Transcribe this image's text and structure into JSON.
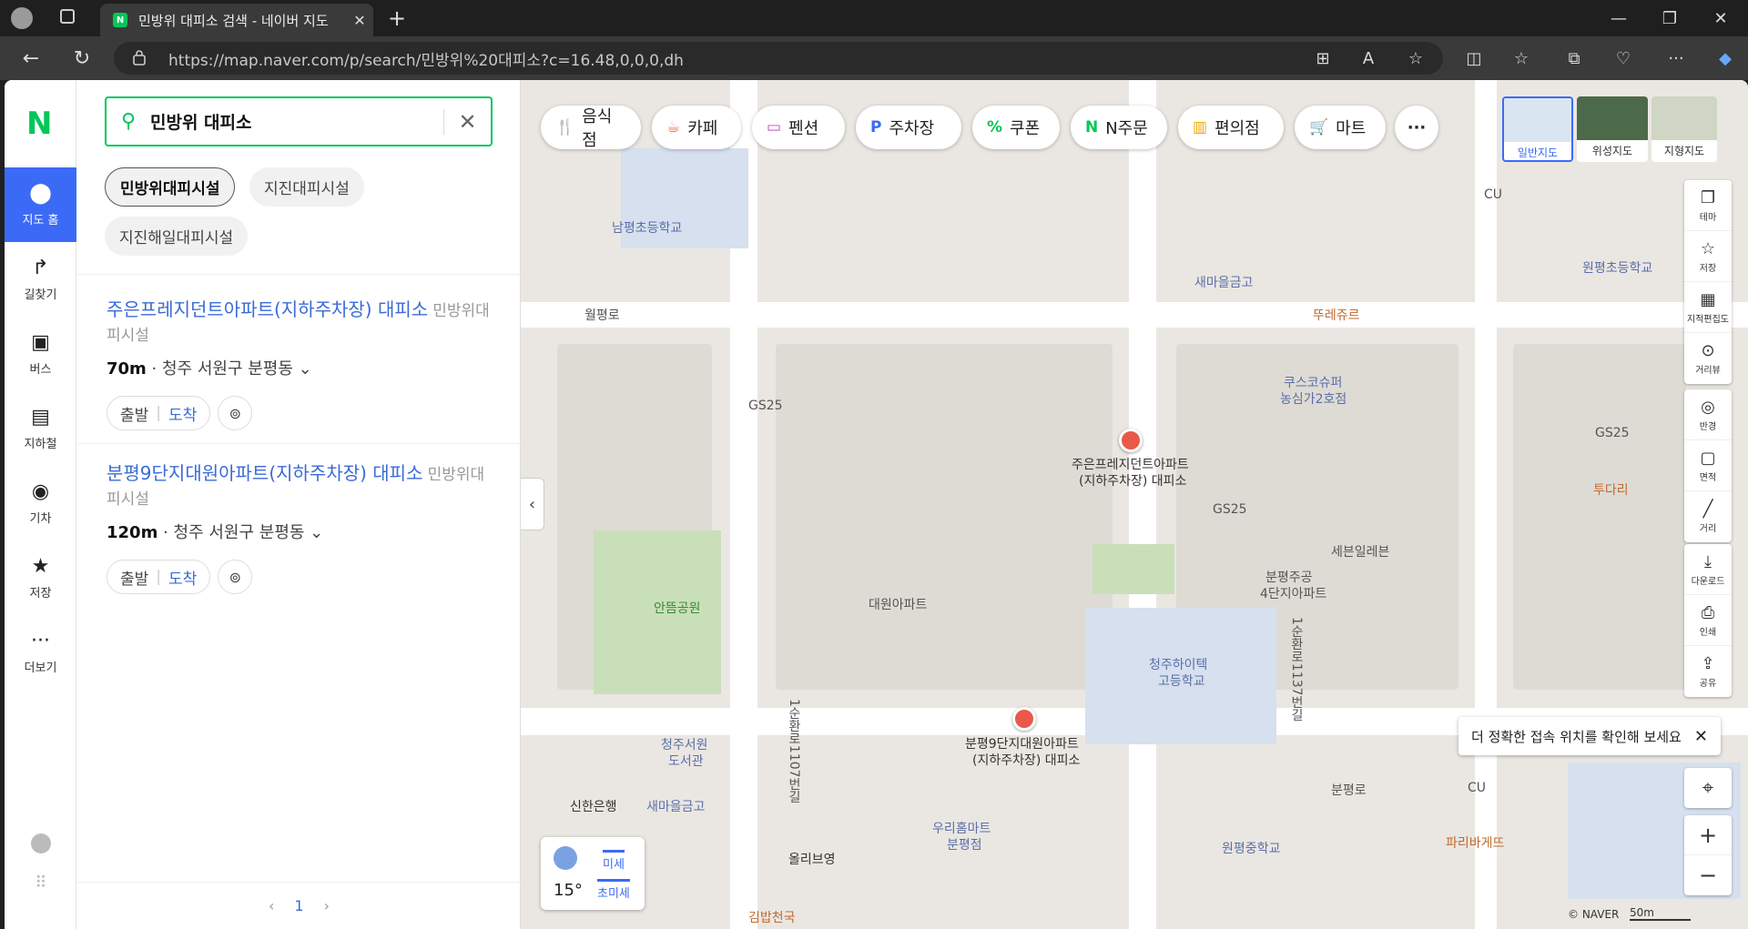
{
  "browser": {
    "tab_title": "민방위 대피소 검색 - 네이버 지도",
    "tab_close": "✕",
    "new_tab": "+",
    "url": "https://map.naver.com/p/search/민방위%20대피소?c=16.48,0,0,0,dh",
    "window_min": "—",
    "window_max": "❐",
    "window_close": "✕"
  },
  "lnav": {
    "logo": "N",
    "items": [
      {
        "label": "지도 홈",
        "icon": "⬤"
      },
      {
        "label": "길찾기",
        "icon": "↱"
      },
      {
        "label": "버스",
        "icon": "▣"
      },
      {
        "label": "지하철",
        "icon": "▤"
      },
      {
        "label": "기차",
        "icon": "◉"
      },
      {
        "label": "저장",
        "icon": "★"
      },
      {
        "label": "더보기",
        "icon": "···"
      }
    ]
  },
  "search": {
    "query": "민방위 대피소"
  },
  "chips": [
    "민방위대피시설",
    "지진대피시설",
    "지진해일대피시설"
  ],
  "results": [
    {
      "name": "주은프레지던트아파트(지하주차장) 대피소",
      "category": "민방위대피시설",
      "distance": "70m",
      "address": "청주 서원구 분평동",
      "depart": "출발",
      "arrive": "도착"
    },
    {
      "name": "분평9단지대원아파트(지하주차장) 대피소",
      "category": "민방위대피시설",
      "distance": "120m",
      "address": "청주 서원구 분평동",
      "depart": "출발",
      "arrive": "도착"
    }
  ],
  "pager": {
    "prev": "‹",
    "current": "1",
    "next": "›"
  },
  "categories": [
    {
      "label": "음식점",
      "icon": "🍴",
      "color": "#e8734a"
    },
    {
      "label": "카페",
      "icon": "☕",
      "color": "#e8734a"
    },
    {
      "label": "펜션",
      "icon": "▭",
      "color": "#c04fb6"
    },
    {
      "label": "주차장",
      "icon": "P",
      "color": "#3b6bf6"
    },
    {
      "label": "쿠폰",
      "icon": "%",
      "color": "#03c75a"
    },
    {
      "label": "N주문",
      "icon": "N",
      "color": "#03c75a"
    },
    {
      "label": "편의점",
      "icon": "▥",
      "color": "#f0a500"
    },
    {
      "label": "마트",
      "icon": "🛒",
      "color": "#f0a500"
    }
  ],
  "more_categories": "···",
  "map_types": [
    "일반지도",
    "위성지도",
    "지형지도"
  ],
  "tools": [
    {
      "label": "테마",
      "icon": "❐"
    },
    {
      "label": "저장",
      "icon": "☆"
    },
    {
      "label": "지적편집도",
      "icon": "▦"
    },
    {
      "label": "거리뷰",
      "icon": "⊙"
    },
    {
      "label": "반경",
      "icon": "◎"
    },
    {
      "label": "면적",
      "icon": "▢"
    },
    {
      "label": "거리",
      "icon": "╱"
    },
    {
      "label": "다운로드",
      "icon": "⤓"
    },
    {
      "label": "인쇄",
      "icon": "⎙"
    },
    {
      "label": "공유",
      "icon": "⇪"
    }
  ],
  "toast": "더 정확한 접속 위치를 확인해 보세요",
  "weather": {
    "temp": "15°",
    "dust": "미세",
    "fine_dust": "초미세"
  },
  "markers": [
    {
      "label1": "주은프레지던트아파트",
      "label2": "(지하주차장) 대피소"
    },
    {
      "label1": "분평9단지대원아파트",
      "label2": "(지하주차장) 대피소"
    }
  ],
  "map_labels": {
    "school1": "남평초등학교",
    "road1": "월평로",
    "bank1": "새마을금고",
    "cafe1": "뚜레쥬르",
    "super": "쿠스코슈퍼",
    "super2": "농심가2호점",
    "gs1": "GS25",
    "gs2": "GS25",
    "gs3": "GS25",
    "cu1": "CU",
    "cu2": "CU",
    "seven": "세븐일레븐",
    "apt1": "대원아파트",
    "park": "안뜸공원",
    "hs": "청주하이텍",
    "hs2": "고등학교",
    "lib": "청주서원",
    "lib2": "도서관",
    "shinhan": "신한은행",
    "bank2": "새마을금고",
    "woori": "우리홈마트",
    "woori2": "분평점",
    "olive": "올리브영",
    "gimbap": "김밥천국",
    "ms": "원평중학교",
    "bakery": "파리바게뜨",
    "ps": "원평초등학교",
    "bunpyeong": "분평주공",
    "bunpyeong2": "4단지아파트",
    "road2": "분평로",
    "tours": "투다리",
    "road3": "1순환로1107번길",
    "road4": "1순환로1137번길",
    "naver": "© NAVER",
    "scale": "50m"
  }
}
